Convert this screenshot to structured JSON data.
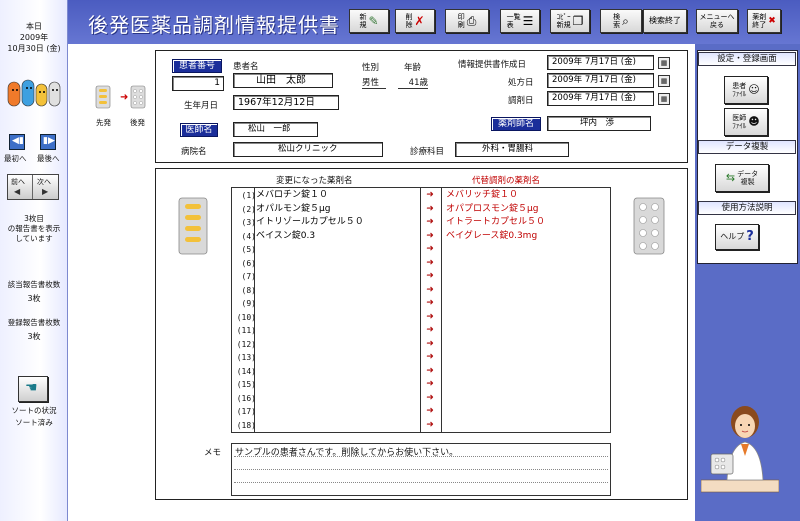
{
  "app_title": "後発医薬品調剤情報提供書",
  "toolbar": {
    "buttons": [
      {
        "label": "新\n規",
        "icon": "new-document-icon"
      },
      {
        "label": "削\n除",
        "icon": "delete-icon"
      },
      {
        "label": "印\n刷",
        "icon": "printer-icon"
      },
      {
        "label": "一覧\n表",
        "icon": "list-icon"
      },
      {
        "label": "ｺﾋﾟｰ\n新規",
        "icon": "copy-icon"
      },
      {
        "label": "検\n索",
        "icon": "magnifier-icon"
      },
      {
        "label": "検索終了",
        "icon": ""
      },
      {
        "label": "メニューへ\n戻る",
        "icon": ""
      },
      {
        "label": "薬剤\n終了",
        "icon": "close-icon"
      }
    ]
  },
  "sidebar": {
    "today_label": "本日",
    "today_year": "2009年",
    "today_date": "10月30日 (金)",
    "before_label": "先発",
    "after_label": "後発",
    "first_label": "最初へ",
    "last_label": "最後へ",
    "prev_label": "前へ",
    "next_label": "次へ",
    "position_text": "3枚目\nの報告書を表示\nしています",
    "count_label": "該当報告書枚数",
    "count_value": "3枚",
    "registered_label": "登録報告書枚数",
    "registered_value": "3枚",
    "sort_label": "ソートの状況",
    "sort_value": "ソート済み"
  },
  "patient": {
    "id_label": "患者番号",
    "id_value": "1",
    "name_label": "患者名",
    "name_value": "山田　太郎",
    "gender_label": "性別",
    "gender_value": "男性",
    "age_label": "年齢",
    "age_value": "41歳",
    "birth_label": "生年月日",
    "birth_value": "1967年12月12日",
    "doctor_label": "医師名",
    "doctor_value": "松山　一郎",
    "hospital_label": "病院名",
    "hospital_value": "松山クリニック",
    "dept_label": "診療科目",
    "dept_value": "外科・胃腸科",
    "pharmacist_label": "薬剤師名",
    "pharmacist_value": "坪内　渉"
  },
  "dates": {
    "created_label": "情報提供書作成日",
    "created_value": "2009年 7月17日 (金)",
    "prescribed_label": "処方日",
    "prescribed_value": "2009年 7月17日 (金)",
    "dispensed_label": "調剤日",
    "dispensed_value": "2009年 7月17日 (金)"
  },
  "medicines": {
    "old_header": "変更になった薬剤名",
    "new_header": "代替調剤の薬剤名",
    "rows": [
      {
        "num": "(1)",
        "old": "メバロチン錠１０",
        "new": "メバリッチ錠１０"
      },
      {
        "num": "(2)",
        "old": "オパルモン錠５μg",
        "new": "オパプロスモン錠５μg"
      },
      {
        "num": "(3)",
        "old": "イトリゾールカプセル５０",
        "new": "イトラートカプセル５０"
      },
      {
        "num": "(4)",
        "old": "ベイスン錠0.3",
        "new": "ベイグレース錠0.3mg"
      },
      {
        "num": "(5)",
        "old": "",
        "new": ""
      },
      {
        "num": "(6)",
        "old": "",
        "new": ""
      },
      {
        "num": "(7)",
        "old": "",
        "new": ""
      },
      {
        "num": "(8)",
        "old": "",
        "new": ""
      },
      {
        "num": "(9)",
        "old": "",
        "new": ""
      },
      {
        "num": "(10)",
        "old": "",
        "new": ""
      },
      {
        "num": "(11)",
        "old": "",
        "new": ""
      },
      {
        "num": "(12)",
        "old": "",
        "new": ""
      },
      {
        "num": "(13)",
        "old": "",
        "new": ""
      },
      {
        "num": "(14)",
        "old": "",
        "new": ""
      },
      {
        "num": "(15)",
        "old": "",
        "new": ""
      },
      {
        "num": "(16)",
        "old": "",
        "new": ""
      },
      {
        "num": "(17)",
        "old": "",
        "new": ""
      },
      {
        "num": "(18)",
        "old": "",
        "new": ""
      }
    ]
  },
  "memo": {
    "label": "メモ",
    "value": "サンプルの患者さんです。削除してからお使い下さい。"
  },
  "side_panel": {
    "settings_header": "設定・登録画面",
    "patient_file": "患者\nﾌｧｲﾙ",
    "doctor_file": "医師\nﾌｧｲﾙ",
    "backup_header": "データ複製",
    "backup_button": "データ\n複製",
    "help_header": "使用方法説明",
    "help_button": "ヘルプ"
  },
  "colors": {
    "accent_blue": "#1b2e9a",
    "band_blue": "#5a6cc6",
    "new_medicine_red": "#c00000"
  }
}
